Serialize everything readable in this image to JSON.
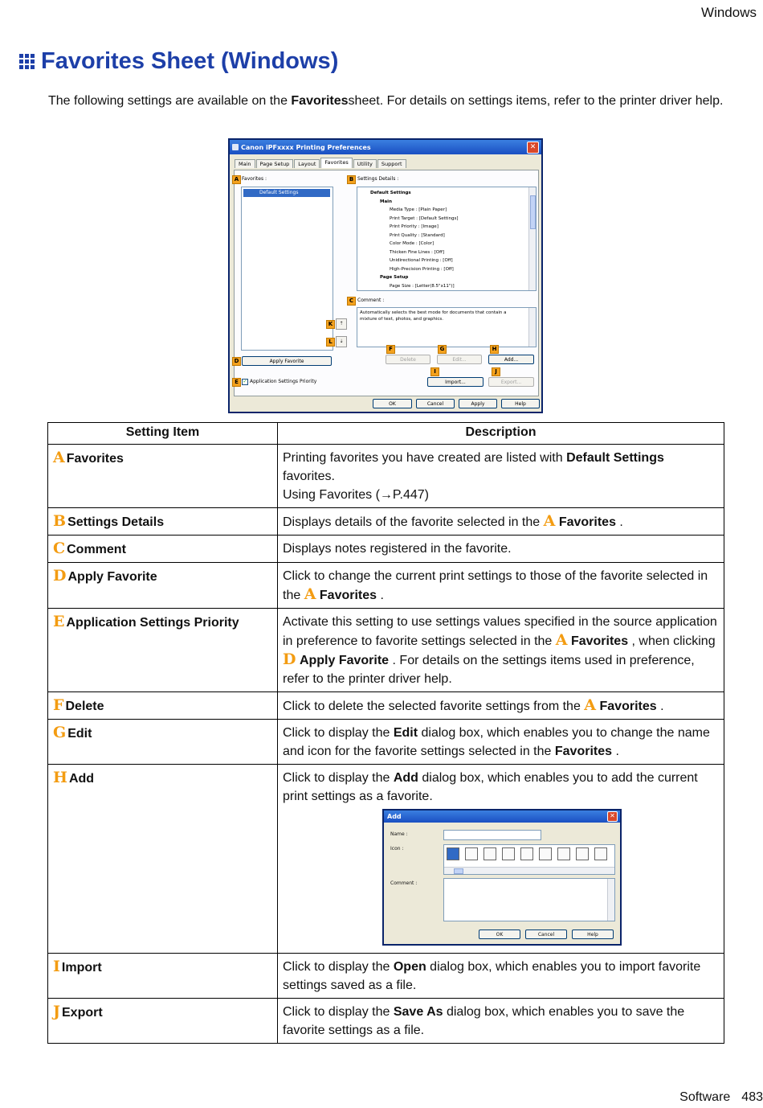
{
  "header": {
    "section": "Windows"
  },
  "title": "Favorites Sheet (Windows)",
  "intro": {
    "before": "The following settings are available on the ",
    "bold": "Favorites",
    "after": "sheet.  For details on settings items, refer to the printer driver help."
  },
  "dialog": {
    "title": "Canon iPFxxxx Printing Preferences",
    "tabs": [
      "Main",
      "Page Setup",
      "Layout",
      "Favorites",
      "Utility",
      "Support"
    ],
    "favorites_label": "Favorites :",
    "favorites_item": "Default Settings",
    "settings_details_label": "Settings Details :",
    "tree": [
      "Default Settings",
      "Main",
      "Media Type : [Plain Paper]",
      "Print Target : [Default Settings]",
      "Print Priority : [Image]",
      "Print Quality : [Standard]",
      "Color Mode : [Color]",
      "Thicken Fine Lines : [Off]",
      "Unidirectional Printing : [Off]",
      "High-Precision Printing : [Off]",
      "Page Setup",
      "Page Size : [Letter(8.5\"x11\")]"
    ],
    "comment_label": "Comment :",
    "comment_text": "Automatically selects the best mode for documents that contain a mixture of text, photos, and graphics.",
    "buttons": {
      "apply_favorite": "Apply Favorite",
      "delete": "Delete",
      "edit": "Edit...",
      "add": "Add...",
      "import": "Import...",
      "export": "Export...",
      "ok": "OK",
      "cancel": "Cancel",
      "apply": "Apply",
      "help": "Help"
    },
    "app_priority": "Application Settings Priority",
    "markers": [
      "A",
      "B",
      "C",
      "D",
      "E",
      "F",
      "G",
      "H",
      "I",
      "J",
      "K",
      "L"
    ]
  },
  "table": {
    "headers": [
      "Setting  Item",
      "Description"
    ],
    "rows": [
      {
        "letter": "A",
        "name": "Favorites"
      },
      {
        "letter": "B",
        "name": "Settings Details"
      },
      {
        "letter": "C",
        "name": "Comment"
      },
      {
        "letter": "D",
        "name": "Apply Favorite"
      },
      {
        "letter": "E",
        "name": "Application Settings Priority"
      },
      {
        "letter": "F",
        "name": "Delete"
      },
      {
        "letter": "G",
        "name": "Edit"
      },
      {
        "letter": "H",
        "name": "Add"
      },
      {
        "letter": "I",
        "name": "Import"
      },
      {
        "letter": "J",
        "name": "Export"
      }
    ],
    "desc": {
      "a1": "Printing favorites you have created are listed with ",
      "a_bold": "Default Settings",
      "a2": " favorites.",
      "a3": "Using Favorites (→P.447)",
      "b1": "Displays details of the favorite selected in the ",
      "b_letter": "A",
      "b_bold": "Favorites",
      "b2": " .",
      "c1": "Displays notes registered in the favorite.",
      "d1": "Click to change the current print settings to those of the favorite selected in the ",
      "d_letter": "A",
      "d_bold": "Favorites",
      "d2": " .",
      "e1": "Activate this setting to use settings values specified in the source application in preference to favorite settings selected in the ",
      "e_letter1": "A",
      "e_bold1": "Favorites",
      "e2": " , when clicking ",
      "e_letter2": "D",
      "e_bold2": "Apply Favorite",
      "e3": " .  For details on the settings items used in preference, refer to the printer driver help.",
      "f1": "Click to delete the selected favorite settings from the ",
      "f_letter": "A",
      "f_bold": "Favorites",
      "f2": " .",
      "g1": "Click to display the ",
      "g_bold1": "Edit",
      "g2": " dialog box, which enables you to change the name and icon for the favorite settings selected in the ",
      "g_bold2": "Favorites",
      "g3": " .",
      "h1": "Click to display the ",
      "h_bold": "Add",
      "h2": " dialog box, which enables you to add the current print settings as a favorite.",
      "i1": "Click to display the ",
      "i_bold": "Open",
      "i2": " dialog box, which enables you to import favorite settings saved as a file.",
      "j1": "Click to display the ",
      "j_bold": "Save As",
      "j2": " dialog box, which enables you to save the favorite settings as a file."
    }
  },
  "add_dialog": {
    "title": "Add",
    "name_label": "Name :",
    "icon_label": "Icon :",
    "comment_label": "Comment :",
    "ok": "OK",
    "cancel": "Cancel",
    "help": "Help"
  },
  "footer": {
    "section": "Software",
    "page": "483"
  }
}
